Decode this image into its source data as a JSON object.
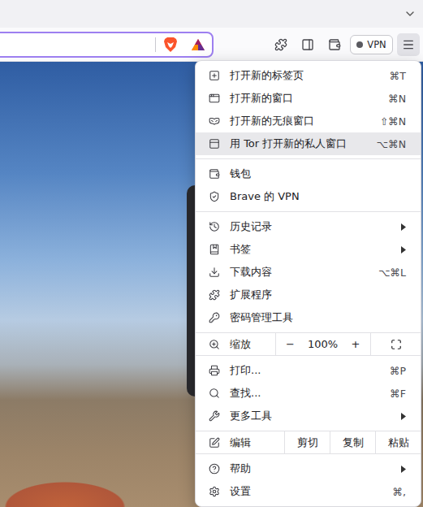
{
  "toolbar": {
    "vpn": {
      "label": "VPN",
      "connected": false
    }
  },
  "menu": {
    "sections": [
      {
        "kind": "items",
        "items": [
          {
            "label": "打开新的标签页",
            "shortcut": "⌘T",
            "submenu": false,
            "selected": false
          },
          {
            "label": "打开新的窗口",
            "shortcut": "⌘N",
            "submenu": false,
            "selected": false
          },
          {
            "label": "打开新的无痕窗口",
            "shortcut": "⇧⌘N",
            "submenu": false,
            "selected": false
          },
          {
            "label": "用 Tor 打开新的私人窗口",
            "shortcut": "⌥⌘N",
            "submenu": false,
            "selected": true
          }
        ]
      },
      {
        "kind": "items",
        "items": [
          {
            "label": "钱包",
            "shortcut": "",
            "submenu": false,
            "selected": false
          },
          {
            "label": "Brave 的 VPN",
            "shortcut": "",
            "submenu": false,
            "selected": false
          }
        ]
      },
      {
        "kind": "items",
        "items": [
          {
            "label": "历史记录",
            "shortcut": "",
            "submenu": true,
            "selected": false
          },
          {
            "label": "书签",
            "shortcut": "",
            "submenu": true,
            "selected": false
          },
          {
            "label": "下载内容",
            "shortcut": "⌥⌘L",
            "submenu": false,
            "selected": false
          },
          {
            "label": "扩展程序",
            "shortcut": "",
            "submenu": false,
            "selected": false
          },
          {
            "label": "密码管理工具",
            "shortcut": "",
            "submenu": false,
            "selected": false
          }
        ]
      },
      {
        "kind": "zoom",
        "label": "缩放",
        "minus": "−",
        "value": "100%",
        "plus": "+"
      },
      {
        "kind": "items",
        "items": [
          {
            "label": "打印...",
            "shortcut": "⌘P",
            "submenu": false,
            "selected": false
          },
          {
            "label": "查找...",
            "shortcut": "⌘F",
            "submenu": false,
            "selected": false
          },
          {
            "label": "更多工具",
            "shortcut": "",
            "submenu": true,
            "selected": false
          }
        ]
      },
      {
        "kind": "edit",
        "label": "编辑",
        "actions": [
          "剪切",
          "复制",
          "粘贴"
        ]
      },
      {
        "kind": "items",
        "items": [
          {
            "label": "帮助",
            "shortcut": "",
            "submenu": true,
            "selected": false
          },
          {
            "label": "设置",
            "shortcut": "⌘,",
            "submenu": false,
            "selected": false
          }
        ]
      }
    ]
  }
}
